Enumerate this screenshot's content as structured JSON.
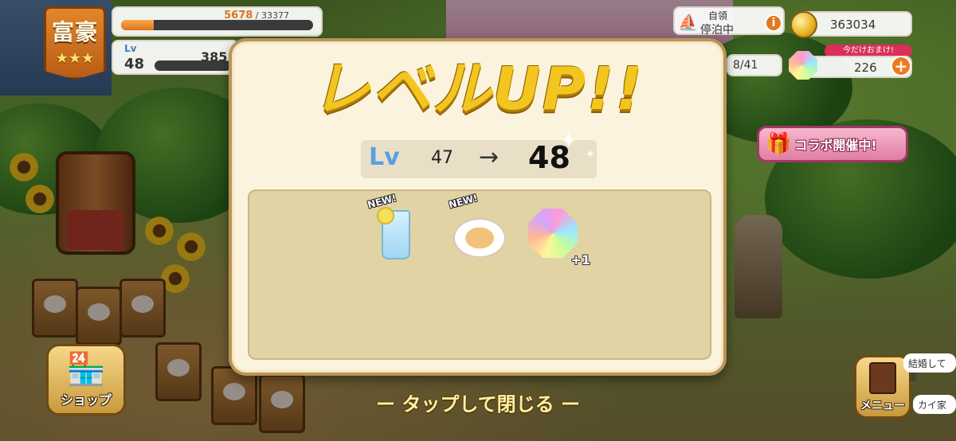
{
  "hud": {
    "rank_title": "富豪",
    "rank_stars": "★★★",
    "xp_current": "5678",
    "xp_total": "33377",
    "xp_fraction": 0.17,
    "level_label": "Lv",
    "level_value": "48",
    "level_next_partial": "385",
    "port_title": "自領",
    "port_status": "停泊中",
    "coins": "363034",
    "bonus_tag": "今だけおまけ!",
    "gems": "226",
    "stock": "8/41",
    "collab_label": "コラボ開催中!",
    "shop_label": "ショップ",
    "menu_label": "メニュー",
    "bubble_1": "結婚して家",
    "bubble_2": "カイ家"
  },
  "modal": {
    "title": "レベルUP!!",
    "lv_word": "Lv",
    "old_level": "47",
    "arrow": "→",
    "new_level": "48",
    "rewards": [
      {
        "name": "lemon-soda",
        "tag": "NEW!",
        "quantity": ""
      },
      {
        "name": "pasta",
        "tag": "NEW!",
        "quantity": ""
      },
      {
        "name": "rainbow-gem",
        "tag": "",
        "quantity": "+1"
      }
    ]
  },
  "close_hint": "ー タップして閉じる ー"
}
